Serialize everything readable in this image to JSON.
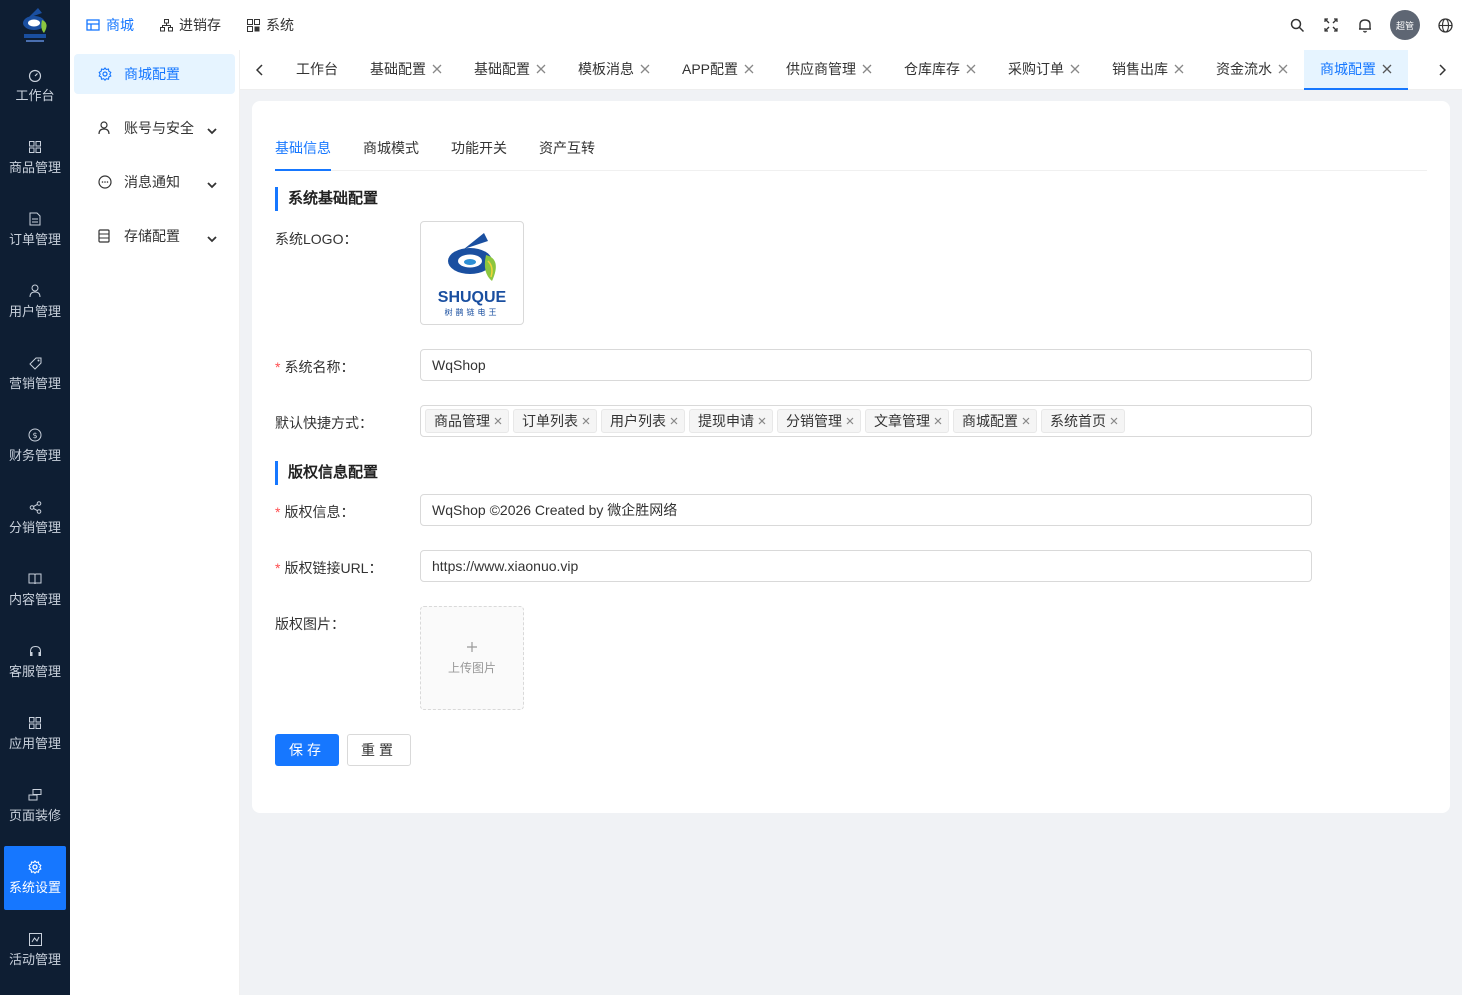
{
  "brand": {
    "logo_text": "SHUQUE",
    "logo_subtext": "树鹊链电王",
    "accent": "#1677ff"
  },
  "leftnav": [
    {
      "label": "工作台",
      "icon": "dashboard-icon"
    },
    {
      "label": "商品管理",
      "icon": "grid-icon"
    },
    {
      "label": "订单管理",
      "icon": "document-icon"
    },
    {
      "label": "用户管理",
      "icon": "user-icon"
    },
    {
      "label": "营销管理",
      "icon": "tag-icon"
    },
    {
      "label": "财务管理",
      "icon": "dollar-icon"
    },
    {
      "label": "分销管理",
      "icon": "share-icon"
    },
    {
      "label": "内容管理",
      "icon": "book-icon"
    },
    {
      "label": "客服管理",
      "icon": "headset-icon"
    },
    {
      "label": "应用管理",
      "icon": "apps-icon"
    },
    {
      "label": "页面装修",
      "icon": "layout-icon"
    },
    {
      "label": "系统设置",
      "icon": "settings-icon"
    },
    {
      "label": "活动管理",
      "icon": "activity-icon"
    }
  ],
  "topmenu": [
    {
      "label": "商城",
      "icon": "store-icon"
    },
    {
      "label": "进销存",
      "icon": "hierarchy-icon"
    },
    {
      "label": "系统",
      "icon": "system-icon"
    }
  ],
  "user": {
    "avatar_text": "超管"
  },
  "subnav": [
    {
      "label": "商城配置",
      "icon": "gear-icon"
    },
    {
      "label": "账号与安全",
      "icon": "user-icon"
    },
    {
      "label": "消息通知",
      "icon": "chat-icon"
    },
    {
      "label": "存储配置",
      "icon": "storage-icon"
    }
  ],
  "tabs": [
    "工作台",
    "基础配置",
    "基础配置",
    "模板消息",
    "APP配置",
    "供应商管理",
    "仓库库存",
    "采购订单",
    "销售出库",
    "资金流水",
    "商城配置"
  ],
  "inner_tabs": [
    "基础信息",
    "商城模式",
    "功能开关",
    "资产互转"
  ],
  "form": {
    "section_basic": "系统基础配置",
    "logo_label": "系统LOGO：",
    "name_label": "系统名称：",
    "name_value": "WqShop",
    "shortcut_label": "默认快捷方式：",
    "shortcuts": [
      "商品管理",
      "订单列表",
      "用户列表",
      "提现申请",
      "分销管理",
      "文章管理",
      "商城配置",
      "系统首页"
    ],
    "section_copyright": "版权信息配置",
    "copyright_label": "版权信息：",
    "copyright_value": "WqShop ©2026 Created by  微企胜网络",
    "copyright_url_label": "版权链接URL：",
    "copyright_url_value": "https://www.xiaonuo.vip",
    "copyright_image_label": "版权图片：",
    "upload_text": "上传图片",
    "save": "保存",
    "reset": "重置"
  }
}
